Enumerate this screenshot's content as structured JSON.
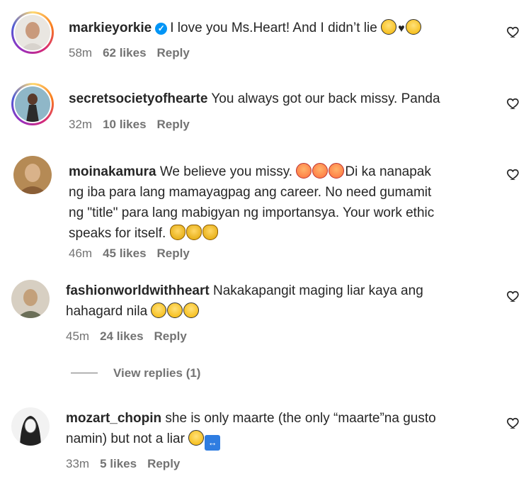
{
  "comments": [
    {
      "username": "markieyorkie",
      "verified": true,
      "text": "I love you Ms.Heart! And I didn’t lie",
      "emojis": [
        "face-with-tears-of-joy",
        "black-heart",
        "smiling-face"
      ],
      "time": "58m",
      "likes": "62 likes",
      "reply": "Reply"
    },
    {
      "username": "secretsocietyofhearte",
      "verified": false,
      "text": "You always got our back missy. Panda",
      "time": "32m",
      "likes": "10 likes",
      "reply": "Reply"
    },
    {
      "username": "moinakamura",
      "verified": false,
      "text_line1": "We believe you missy.",
      "text_line1b": "Di ka nanapak",
      "text_line2": "ng iba para lang mamayagpag ang career. No need gumamit",
      "text_line3": "ng \"title\" para lang mabigyan ng importansya. Your work ethic",
      "text_line4": "speaks for itself.",
      "emojis_a": [
        "smiling-face-with-hearts",
        "smiling-face-with-hearts",
        "smiling-face-with-hearts"
      ],
      "emojis_b": [
        "clapping-hands",
        "clapping-hands",
        "clapping-hands"
      ],
      "time": "46m",
      "likes": "45 likes",
      "reply": "Reply"
    },
    {
      "username": "fashionworldwithheart",
      "verified": false,
      "text_line1": "Nakakapangit maging liar kaya ang",
      "text_line2": "hahagard nila",
      "emojis": [
        "face-with-tears-of-joy",
        "face-with-tears-of-joy",
        "face-with-tears-of-joy"
      ],
      "time": "45m",
      "likes": "24 likes",
      "reply": "Reply",
      "view_replies": "View replies (1)"
    },
    {
      "username": "mozart_chopin",
      "verified": false,
      "text_line1": "she is only maarte (the only “maarte”na gusto",
      "text_line2": "namin) but not a liar",
      "emojis": [
        "slightly-smiling-face",
        "left-right-arrow"
      ],
      "time": "33m",
      "likes": "5 likes",
      "reply": "Reply"
    }
  ],
  "icons": {
    "like": "heart-outline-icon",
    "verified": "verified-badge-icon"
  },
  "colors": {
    "text": "#262626",
    "secondary": "#737373",
    "verified": "#0095f6"
  }
}
